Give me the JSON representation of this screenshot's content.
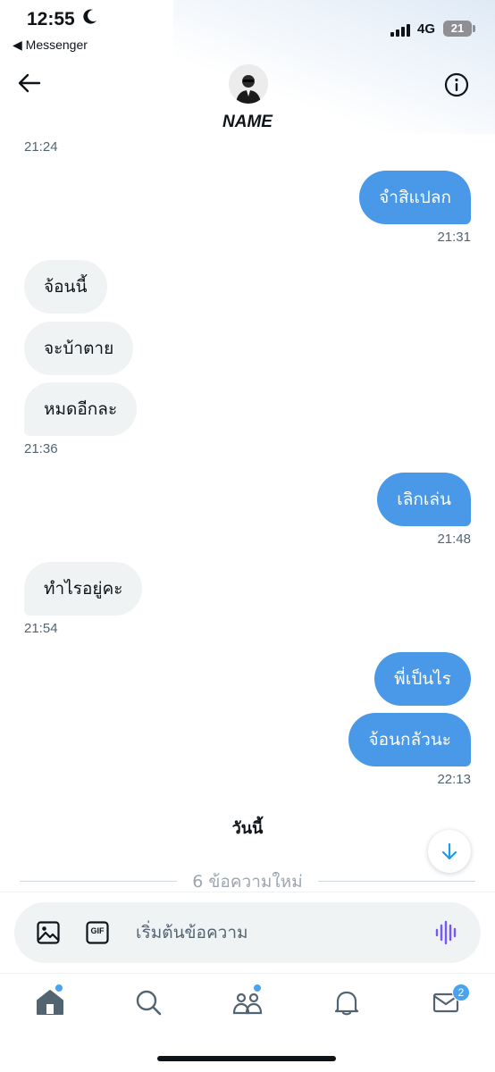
{
  "status_bar": {
    "time": "12:55",
    "back_app": "◀ Messenger",
    "network": "4G",
    "battery": "21"
  },
  "header": {
    "contact_name": "NAME"
  },
  "messages": [
    {
      "type": "timestamp",
      "text": "21:24"
    },
    {
      "type": "sent",
      "text": "จำสิแปลก"
    },
    {
      "type": "timestamp",
      "text": "21:31"
    },
    {
      "type": "received",
      "text": "จ้อนนี้"
    },
    {
      "type": "received",
      "text": "จะบ้าตาย"
    },
    {
      "type": "received",
      "text": "หมดอีกละ"
    },
    {
      "type": "timestamp",
      "text": "21:36"
    },
    {
      "type": "sent",
      "text": "เลิกเล่น"
    },
    {
      "type": "timestamp",
      "text": "21:48"
    },
    {
      "type": "received",
      "text": "ทำไรอยู่คะ"
    },
    {
      "type": "timestamp",
      "text": "21:54"
    },
    {
      "type": "sent",
      "text": "พี่เป็นไร"
    },
    {
      "type": "sent",
      "text": "จ้อนกลัวนะ"
    },
    {
      "type": "timestamp",
      "text": "22:13"
    }
  ],
  "day_separator": "วันนี้",
  "new_messages_label": "6 ข้อความใหม่",
  "composer": {
    "placeholder": "เริ่มต้นข้อความ",
    "gif_label": "GIF"
  },
  "tab_bar": {
    "messages_badge": "2",
    "items": [
      "home-icon",
      "search-icon",
      "communities-icon",
      "notifications-icon",
      "messages-icon"
    ]
  },
  "colors": {
    "sent_bubble": "#4a98e8",
    "received_bubble": "#eff3f4",
    "accent": "#1d9bf0",
    "voice_icon": "#7856ff"
  }
}
